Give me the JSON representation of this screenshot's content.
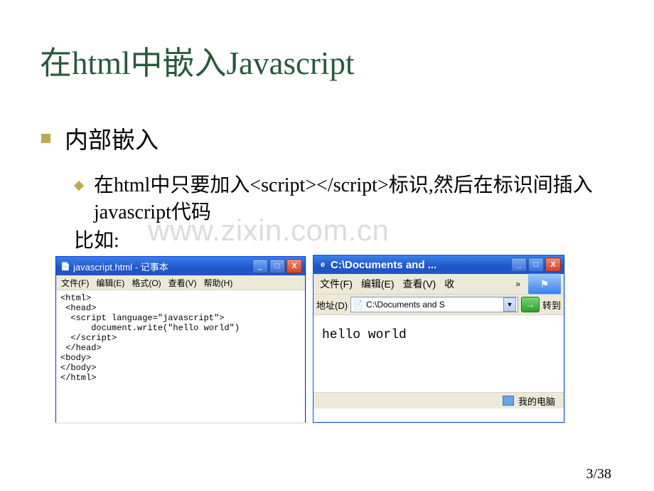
{
  "title": "在html中嵌入Javascript",
  "bullets": {
    "level1": "内部嵌入",
    "level2": "在html中只要加入<script></script>标识,然后在标识间插入javascript代码",
    "example_label": "比如:"
  },
  "watermark": "www.zixin.com.cn",
  "page_number": "3/38",
  "notepad": {
    "title": "javascript.html - 记事本",
    "icon": "notepad-icon",
    "btn_min": "_",
    "btn_max": "□",
    "btn_close": "X",
    "menu": [
      "文件(F)",
      "编辑(E)",
      "格式(O)",
      "查看(V)",
      "帮助(H)"
    ],
    "content": "<html>\n <head>\n  <script language=\"javascript\">\n      document.write(\"hello world\")\n  </script>\n </head>\n<body>\n</body>\n</html>"
  },
  "ie": {
    "title": "C:\\Documents and ...",
    "icon": "ie-icon",
    "btn_min": "_",
    "btn_max": "□",
    "btn_close": "X",
    "menu": [
      "文件(F)",
      "编辑(E)",
      "查看(V)",
      "收"
    ],
    "chevron": "»",
    "logo": "ie-flag-icon",
    "addr_label": "地址(D)",
    "addr_value": "C:\\Documents and S",
    "addr_icon": "file-icon",
    "dropdown": "▼",
    "go_arrow": "→",
    "go_label": "转到",
    "body": "hello world",
    "status_icon": "monitor-icon",
    "status_text": "我的电脑"
  }
}
